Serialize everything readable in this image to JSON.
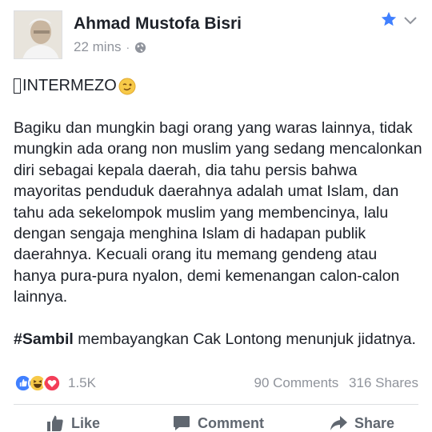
{
  "post": {
    "author": "Ahmad Mustofa Bisri",
    "timestamp": "22 mins",
    "separator": "·",
    "privacy_icon": "globe-icon",
    "header_icons": [
      "star-icon",
      "chevron-down-icon"
    ],
    "intermezo": "INTERMEZO",
    "paragraph_1": "Bagiku dan mungkin bagi orang yang waras lainnya, tidak mungkin ada orang non muslim yang sedang mencalonkan diri sebagai kepala daerah, dia tahu persis bahwa mayoritas penduduk daerahnya adalah umat Islam, dan tahu ada sekelompok muslim yang membencinya, lalu dengan sengaja menghina Islam di hadapan publik daerahnya. Kecuali orang itu memang gendeng atau hanya pura-pura nyalon, demi kemenangan calon-calon lainnya.",
    "hashtag": "#Sambil",
    "paragraph_2_rest": " membayangkan Cak Lontong menunjuk jidatnya."
  },
  "engagement": {
    "reaction_icons": [
      "like-reaction-icon",
      "haha-reaction-icon",
      "love-reaction-icon"
    ],
    "reactions_count": "1.5K",
    "comments": "90 Comments",
    "shares": "316 Shares"
  },
  "actions": {
    "like": "Like",
    "comment": "Comment",
    "share": "Share"
  },
  "colors": {
    "text": "#1d2129",
    "meta": "#90949c",
    "accent": "#4080ff",
    "action": "#606770"
  }
}
